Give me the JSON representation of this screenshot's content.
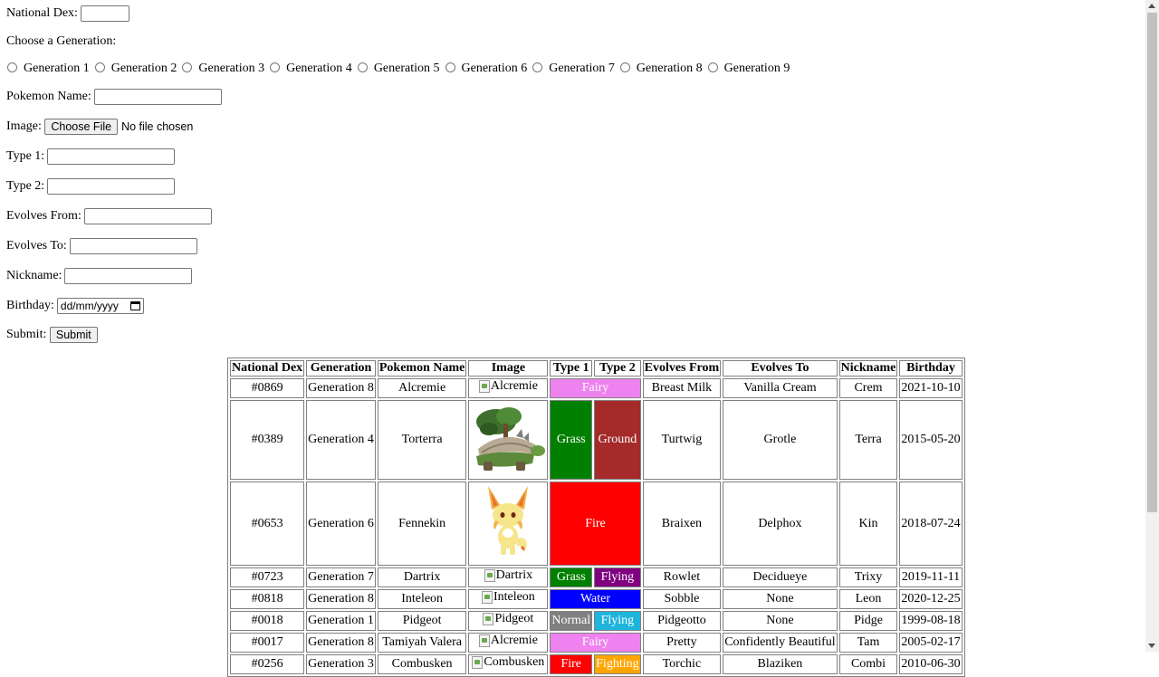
{
  "form": {
    "national_dex_label": "National Dex:",
    "generation_prompt": "Choose a Generation:",
    "generations": [
      "Generation 1",
      "Generation 2",
      "Generation 3",
      "Generation 4",
      "Generation 5",
      "Generation 6",
      "Generation 7",
      "Generation 8",
      "Generation 9"
    ],
    "pokemon_name_label": "Pokemon Name:",
    "image_label": "Image:",
    "choose_file_button": "Choose File",
    "no_file_text": "No file chosen",
    "type1_label": "Type 1:",
    "type2_label": "Type 2:",
    "evolves_from_label": "Evolves From:",
    "evolves_to_label": "Evolves To:",
    "nickname_label": "Nickname:",
    "birthday_label": "Birthday:",
    "birthday_placeholder": "dd/mm/yyyy",
    "submit_label": "Submit:",
    "submit_button": "Submit"
  },
  "table": {
    "headers": [
      "National Dex",
      "Generation",
      "Pokemon Name",
      "Image",
      "Type 1",
      "Type 2",
      "Evolves From",
      "Evolves To",
      "Nickname",
      "Birthday"
    ],
    "rows": [
      {
        "dex": "#0869",
        "gen": "Generation 8",
        "name": "Alcremie",
        "image_alt": "Alcremie",
        "image_loaded": false,
        "type1": "Fairy",
        "type1_color": "#ee82ee",
        "type2": "",
        "type2_color": "",
        "from": "Breast Milk",
        "to": "Vanilla Cream",
        "nickname": "Crem",
        "birthday": "2021-10-10"
      },
      {
        "dex": "#0389",
        "gen": "Generation 4",
        "name": "Torterra",
        "image_alt": "Torterra",
        "image_loaded": true,
        "sprite": "torterra",
        "type1": "Grass",
        "type1_color": "#008000",
        "type2": "Ground",
        "type2_color": "#a52a2a",
        "from": "Turtwig",
        "to": "Grotle",
        "nickname": "Terra",
        "birthday": "2015-05-20"
      },
      {
        "dex": "#0653",
        "gen": "Generation 6",
        "name": "Fennekin",
        "image_alt": "Fennekin",
        "image_loaded": true,
        "sprite": "fennekin",
        "type1": "Fire",
        "type1_color": "#ff0000",
        "type2": "",
        "type2_color": "",
        "from": "Braixen",
        "to": "Delphox",
        "nickname": "Kin",
        "birthday": "2018-07-24"
      },
      {
        "dex": "#0723",
        "gen": "Generation 7",
        "name": "Dartrix",
        "image_alt": "Dartrix",
        "image_loaded": false,
        "type1": "Grass",
        "type1_color": "#008000",
        "type2": "Flying",
        "type2_color": "#800080",
        "from": "Rowlet",
        "to": "Decidueye",
        "nickname": "Trixy",
        "birthday": "2019-11-11"
      },
      {
        "dex": "#0818",
        "gen": "Generation 8",
        "name": "Inteleon",
        "image_alt": "Inteleon",
        "image_loaded": false,
        "type1": "Water",
        "type1_color": "#0000ff",
        "type2": "",
        "type2_color": "",
        "from": "Sobble",
        "to": "None",
        "nickname": "Leon",
        "birthday": "2020-12-25"
      },
      {
        "dex": "#0018",
        "gen": "Generation 1",
        "name": "Pidgeot",
        "image_alt": "Pidgeot",
        "image_loaded": false,
        "type1": "Normal",
        "type1_color": "#808080",
        "type2": "Flying",
        "type2_color": "#1eb4dc",
        "from": "Pidgeotto",
        "to": "None",
        "nickname": "Pidge",
        "birthday": "1999-08-18"
      },
      {
        "dex": "#0017",
        "gen": "Generation 8",
        "name": "Tamiyah Valera",
        "image_alt": "Alcremie",
        "image_loaded": false,
        "type1": "Fairy",
        "type1_color": "#ee82ee",
        "type2": "",
        "type2_color": "",
        "from": "Pretty",
        "to": "Confidently Beautiful",
        "nickname": "Tam",
        "birthday": "2005-02-17"
      },
      {
        "dex": "#0256",
        "gen": "Generation 3",
        "name": "Combusken",
        "image_alt": "Combusken",
        "image_loaded": false,
        "type1": "Fire",
        "type1_color": "#ff0000",
        "type2": "Fighting",
        "type2_color": "#ffa500",
        "from": "Torchic",
        "to": "Blaziken",
        "nickname": "Combi",
        "birthday": "2010-06-30"
      }
    ]
  }
}
